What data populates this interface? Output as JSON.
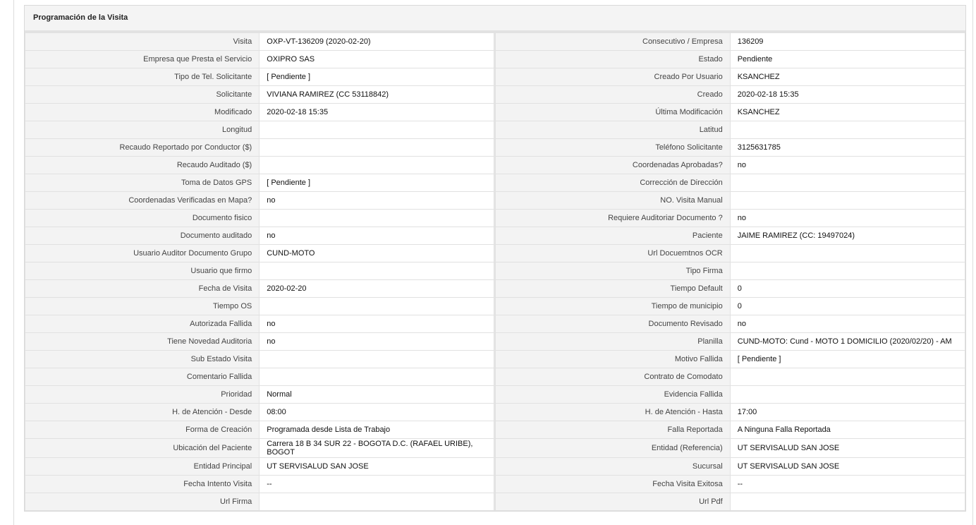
{
  "panel": {
    "title": "Programación de la Visita"
  },
  "rows": [
    {
      "l_label": "Visita",
      "l_value": "OXP-VT-136209 (2020-02-20)",
      "r_label": "Consecutivo / Empresa",
      "r_value": "136209"
    },
    {
      "l_label": "Empresa que Presta el Servicio",
      "l_value": "OXIPRO SAS",
      "r_label": "Estado",
      "r_value": "Pendiente"
    },
    {
      "l_label": "Tipo de Tel. Solicitante",
      "l_value": "[ Pendiente ]",
      "r_label": "Creado Por Usuario",
      "r_value": "KSANCHEZ"
    },
    {
      "l_label": "Solicitante",
      "l_value": "VIVIANA RAMIREZ (CC 53118842)",
      "r_label": "Creado",
      "r_value": "2020-02-18 15:35"
    },
    {
      "l_label": "Modificado",
      "l_value": "2020-02-18 15:35",
      "r_label": "Última Modificación",
      "r_value": " KSANCHEZ"
    },
    {
      "l_label": "Longitud",
      "l_value": "",
      "r_label": "Latitud",
      "r_value": ""
    },
    {
      "l_label": "Recaudo Reportado por Conductor ($)",
      "l_value": "",
      "r_label": "Teléfono Solicitante",
      "r_value": "3125631785"
    },
    {
      "l_label": "Recaudo Auditado ($)",
      "l_value": "",
      "r_label": "Coordenadas Aprobadas?",
      "r_value": " no"
    },
    {
      "l_label": "Toma de Datos GPS",
      "l_value": "[ Pendiente ]",
      "r_label": "Corrección de Dirección",
      "r_value": ""
    },
    {
      "l_label": "Coordenadas Verificadas en Mapa?",
      "l_value": " no",
      "r_label": "NO. Visita Manual",
      "r_value": ""
    },
    {
      "l_label": "Documento fisico",
      "l_value": "",
      "r_label": "Requiere Auditoriar Documento ?",
      "r_value": " no"
    },
    {
      "l_label": "Documento auditado",
      "l_value": " no",
      "r_label": "Paciente",
      "r_value": "JAIME RAMIREZ (CC: 19497024)"
    },
    {
      "l_label": "Usuario Auditor Documento Grupo",
      "l_value": "CUND-MOTO",
      "r_label": "Url Docuemtnos OCR",
      "r_value": ""
    },
    {
      "l_label": "Usuario que firmo",
      "l_value": "",
      "r_label": "Tipo Firma",
      "r_value": ""
    },
    {
      "l_label": "Fecha de Visita",
      "l_value": " 2020-02-20",
      "r_label": "Tiempo Default",
      "r_value": "0"
    },
    {
      "l_label": "Tiempo OS",
      "l_value": "",
      "r_label": "Tiempo de municipio",
      "r_value": "0"
    },
    {
      "l_label": "Autorizada Fallida",
      "l_value": " no",
      "r_label": "Documento Revisado",
      "r_value": " no"
    },
    {
      "l_label": "Tiene Novedad Auditoria",
      "l_value": " no",
      "r_label": "Planilla",
      "r_value": "CUND-MOTO: Cund - MOTO 1 DOMICILIO (2020/02/20) - AM"
    },
    {
      "l_label": "Sub Estado Visita",
      "l_value": "",
      "r_label": "Motivo Fallida",
      "r_value": "[ Pendiente ]"
    },
    {
      "l_label": "Comentario Fallida",
      "l_value": "",
      "r_label": "Contrato de Comodato",
      "r_value": ""
    },
    {
      "l_label": "Prioridad",
      "l_value": "Normal",
      "r_label": "Evidencia Fallida",
      "r_value": ""
    },
    {
      "l_label": "H. de Atención - Desde",
      "l_value": "08:00",
      "r_label": "H. de Atención - Hasta",
      "r_value": "17:00"
    },
    {
      "l_label": "Forma de Creación",
      "l_value": "Programada desde Lista de Trabajo",
      "r_label": "Falla Reportada",
      "r_value": "A Ninguna Falla Reportada"
    },
    {
      "l_label": "Ubicación del Paciente",
      "l_value": "Carrera 18 B 34 SUR 22 - BOGOTA D.C. (RAFAEL URIBE), BOGOT",
      "r_label": "Entidad (Referencia)",
      "r_value": "UT SERVISALUD SAN JOSE"
    },
    {
      "l_label": "Entidad Principal",
      "l_value": "UT SERVISALUD SAN JOSE",
      "r_label": "Sucursal",
      "r_value": "UT SERVISALUD SAN JOSE"
    },
    {
      "l_label": "Fecha Intento Visita",
      "l_value": " --",
      "r_label": "Fecha Visita Exitosa",
      "r_value": " --"
    },
    {
      "l_label": "Url Firma",
      "l_value": "",
      "r_label": "Url Pdf",
      "r_value": ""
    }
  ]
}
